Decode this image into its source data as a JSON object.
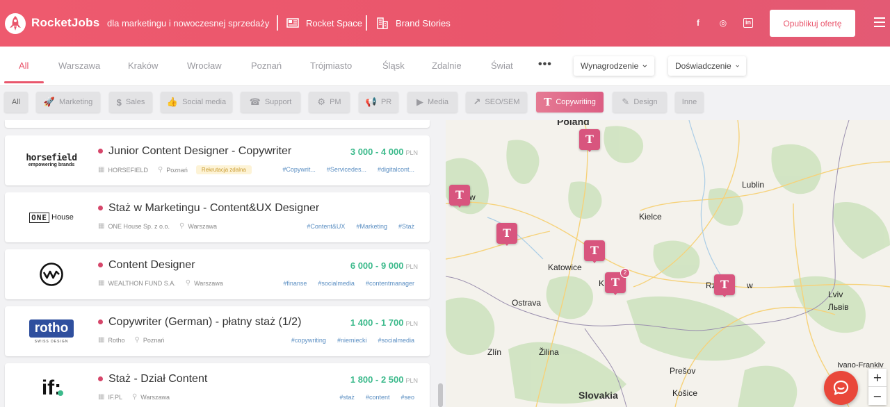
{
  "header": {
    "brand": "RocketJobs",
    "tagline": "dla marketingu i nowoczesnej sprzedaży",
    "links": [
      {
        "label": "Rocket Space",
        "icon": "newspaper-icon"
      },
      {
        "label": "Brand Stories",
        "icon": "building-icon"
      }
    ],
    "social": [
      {
        "name": "facebook-icon",
        "glyph": "f"
      },
      {
        "name": "instagram-icon",
        "glyph": "◎"
      },
      {
        "name": "linkedin-icon",
        "glyph": "in"
      }
    ],
    "publish_label": "Opublikuj ofertę",
    "accent_color": "#e9566c"
  },
  "cities": [
    "All",
    "Warszawa",
    "Kraków",
    "Wrocław",
    "Poznań",
    "Trójmiasto",
    "Śląsk",
    "Zdalnie",
    "Świat"
  ],
  "active_city": "All",
  "filters": {
    "more": "•••",
    "salary_label": "Wynagrodzenie",
    "experience_label": "Doświadczenie"
  },
  "categories": [
    {
      "label": "All",
      "icon": ""
    },
    {
      "label": "Marketing",
      "icon": "rocket-icon"
    },
    {
      "label": "Sales",
      "icon": "dollar-icon"
    },
    {
      "label": "Social media",
      "icon": "thumbs-up-icon"
    },
    {
      "label": "Support",
      "icon": "headset-icon"
    },
    {
      "label": "PM",
      "icon": "head-gear-icon"
    },
    {
      "label": "PR",
      "icon": "megaphone-icon"
    },
    {
      "label": "Media",
      "icon": "play-icon"
    },
    {
      "label": "SEO/SEM",
      "icon": "trend-up-icon"
    },
    {
      "label": "Copywriting",
      "icon": "t-letter-icon",
      "active": true
    },
    {
      "label": "Design",
      "icon": "pencil-ruler-icon"
    },
    {
      "label": "Inne",
      "icon": ""
    }
  ],
  "jobs": [
    {
      "title": "Junior Content Designer - Copywriter",
      "salary": "3 000 - 4 000",
      "currency": "PLN",
      "company": "HORSEFIELD",
      "city": "Poznań",
      "badge": "Rekrutacja zdalna",
      "tags": [
        "#Copywrit...",
        "#Servicedes...",
        "#digitalcont..."
      ],
      "logo": {
        "line1": "horsefield",
        "line2": "empowering brands"
      }
    },
    {
      "title": "Staż w Marketingu - Content&UX Designer",
      "salary": "",
      "currency": "",
      "company": "ONE House Sp. z o.o.",
      "city": "Warszawa",
      "badge": "",
      "tags": [
        "#Content&UX",
        "#Marketing",
        "#Staż"
      ],
      "logo": {
        "line1": "ONE",
        "line2": "House"
      }
    },
    {
      "title": "Content Designer",
      "salary": "6 000 - 9 000",
      "currency": "PLN",
      "company": "WEALTHON FUND S.A.",
      "city": "Warszawa",
      "badge": "",
      "tags": [
        "#finanse",
        "#socialmedia",
        "#contentmanager"
      ],
      "logo": {
        "line1": "",
        "line2": ""
      }
    },
    {
      "title": "Copywriter (German) - płatny staż (1/2)",
      "salary": "1 400 - 1 700",
      "currency": "PLN",
      "company": "Rotho",
      "city": "Poznań",
      "badge": "",
      "tags": [
        "#copywriting",
        "#niemiecki",
        "#socialmedia"
      ],
      "logo": {
        "line1": "rotho",
        "line2": "SWISS DESIGN"
      }
    },
    {
      "title": "Staż - Dział Content",
      "salary": "1 800 - 2 500",
      "currency": "PLN",
      "company": "IF.PL",
      "city": "Warszawa",
      "badge": "",
      "tags": [
        "#staż",
        "#content",
        "#seo"
      ],
      "logo": {
        "line1": "if:",
        "line2": ""
      }
    }
  ],
  "map": {
    "places": [
      {
        "name": "Poland",
        "big": true
      },
      {
        "name": "Lublin"
      },
      {
        "name": "Kielce"
      },
      {
        "name": "Katowice"
      },
      {
        "name": "Ostrava"
      },
      {
        "name": "Lviv"
      },
      {
        "name": "Львів"
      },
      {
        "name": "Zlín"
      },
      {
        "name": "Žilina"
      },
      {
        "name": "Prešov"
      },
      {
        "name": "Košice"
      },
      {
        "name": "Slovakia",
        "big": true
      },
      {
        "name": "Ivano-Frankiv"
      },
      {
        "name": "Rz"
      },
      {
        "name": "w"
      },
      {
        "name": "K"
      },
      {
        "name": "w"
      }
    ],
    "markers": [
      {
        "glyph": "T",
        "count": ""
      },
      {
        "glyph": "T",
        "count": ""
      },
      {
        "glyph": "T",
        "count": ""
      },
      {
        "glyph": "T",
        "count": ""
      },
      {
        "glyph": "T",
        "count": "2"
      },
      {
        "glyph": "T",
        "count": ""
      }
    ],
    "zoom_in": "+",
    "zoom_out": "−"
  }
}
